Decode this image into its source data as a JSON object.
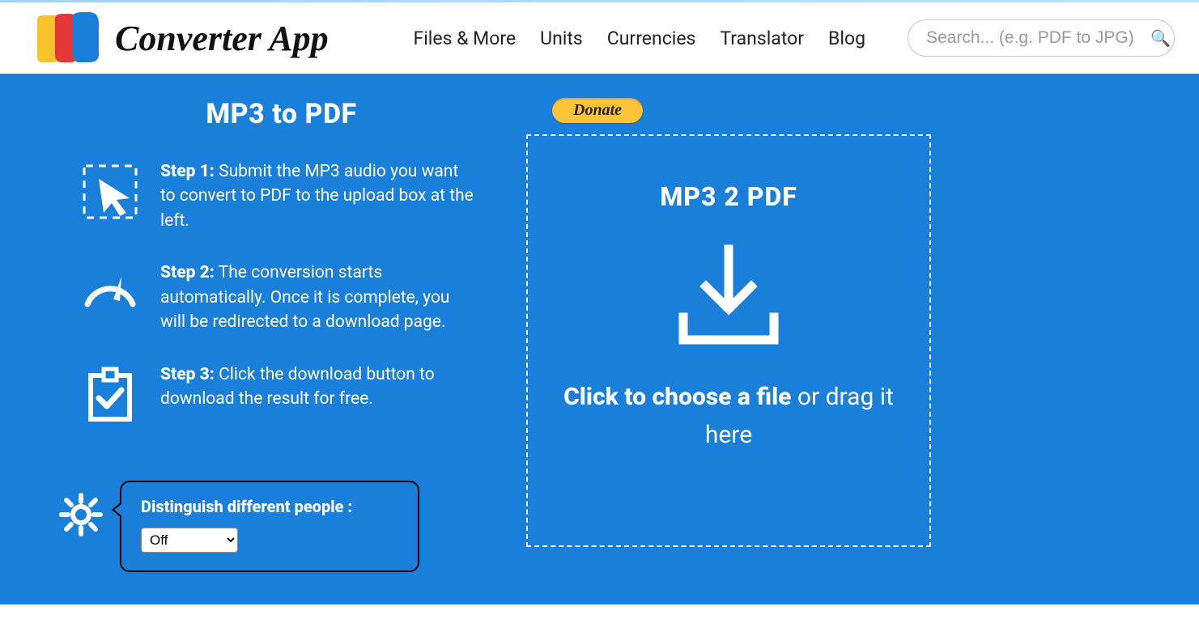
{
  "brand": {
    "name": "Converter App"
  },
  "nav": {
    "items": [
      "Files & More",
      "Units",
      "Currencies",
      "Translator",
      "Blog"
    ]
  },
  "search": {
    "placeholder": "Search... (e.g. PDF to JPG)"
  },
  "page": {
    "title": "MP3 to PDF"
  },
  "steps": [
    {
      "label": "Step 1:",
      "text": "Submit the MP3 audio you want to convert to PDF to the upload box at the left."
    },
    {
      "label": "Step 2:",
      "text": "The conversion starts automatically. Once it is complete, you will be redirected to a download page."
    },
    {
      "label": "Step 3:",
      "text": "Click the download button to download the result for free."
    }
  ],
  "settings": {
    "label": "Distinguish different people :",
    "selected": "Off"
  },
  "donate": {
    "label": "Donate"
  },
  "dropzone": {
    "title": "MP3 2 PDF",
    "cta_bold": "Click to choose a file",
    "cta_rest": " or drag it here"
  }
}
